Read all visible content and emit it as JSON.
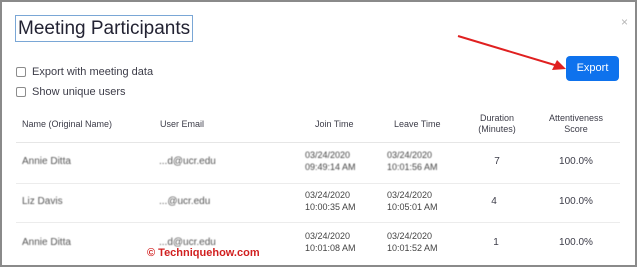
{
  "dialog": {
    "title": "Meeting Participants",
    "close_label": "×"
  },
  "options": {
    "export_with_meeting_data": "Export with meeting data",
    "show_unique_users": "Show unique users"
  },
  "export_button": "Export",
  "table": {
    "headers": {
      "name": "Name (Original Name)",
      "email": "User Email",
      "join": "Join Time",
      "leave": "Leave Time",
      "duration": "Duration (Minutes)",
      "attentiveness": "Attentiveness Score"
    },
    "rows": [
      {
        "name": "Annie Ditta",
        "email": "...d@ucr.edu",
        "join_top": "03/24/2020",
        "join_bottom": "09:49:14 AM",
        "leave_top": "03/24/2020",
        "leave_bottom": "10:01:56 AM",
        "duration": "7",
        "attentiveness": "100.0%"
      },
      {
        "name": "Liz Davis",
        "email": "...@ucr.edu",
        "join_top": "03/24/2020",
        "join_bottom": "10:00:35 AM",
        "leave_top": "03/24/2020",
        "leave_bottom": "10:05:01 AM",
        "duration": "4",
        "attentiveness": "100.0%"
      },
      {
        "name": "Annie Ditta",
        "email": "...d@ucr.edu",
        "join_top": "03/24/2020",
        "join_bottom": "10:01:08 AM",
        "leave_top": "03/24/2020",
        "leave_bottom": "10:01:52 AM",
        "duration": "1",
        "attentiveness": "100.0%"
      }
    ]
  },
  "watermark": "© Techniquehow.com",
  "colors": {
    "accent": "#0e72ed",
    "arrow": "#e02020",
    "watermark": "#d11f1f"
  }
}
